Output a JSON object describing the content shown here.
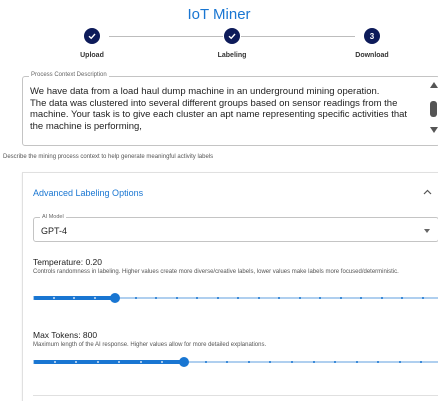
{
  "app": {
    "title": "IoT Miner"
  },
  "stepper": {
    "steps": [
      {
        "label": "Upload",
        "state": "completed"
      },
      {
        "label": "Labeling",
        "state": "completed"
      },
      {
        "label": "Download",
        "state": "active",
        "number": "3"
      }
    ]
  },
  "process_context": {
    "legend": "Process Context Description",
    "value": "We have data from a load haul dump machine in an underground mining operation.\nThe data was clustered into several different groups based on sensor readings from the machine. Your task is to give each cluster an apt name representing specific activities that the machine is performing,",
    "helper": "Describe the mining process context to help generate meaningful activity labels"
  },
  "advanced": {
    "title": "Advanced Labeling Options",
    "model": {
      "legend": "AI Model",
      "value": "GPT-4"
    },
    "temperature": {
      "label": "Temperature: 0.20",
      "description": "Controls randomness in labeling. Higher values create more diverse/creative labels, lower values make labels more focused/deterministic.",
      "value": 0.2,
      "min": 0,
      "max": 1,
      "step": 0.05
    },
    "max_tokens": {
      "label": "Max Tokens: 800",
      "description": "Maximum length of the AI response. Higher values allow for more detailed explanations.",
      "value": 800,
      "min": 100,
      "max": 2000,
      "step": 100
    }
  },
  "colors": {
    "accent": "#1976d2",
    "step": "#0d1b5a",
    "border": "#c4c4c4"
  }
}
